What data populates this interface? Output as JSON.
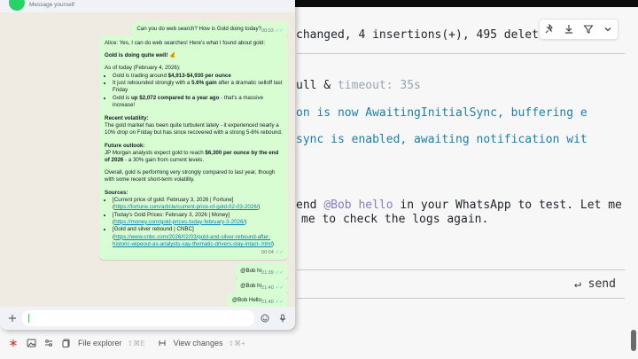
{
  "terminal": {
    "line_changed": "changed, 4 insertions(+), 495 deletions(-",
    "line_ull_prefix": "ull & ",
    "line_ull_timeout": "timeout: 35s",
    "line_sync": "on is now AwaitingInitialSync, buffering e",
    "line_notify": "sync is enabled, awaiting notification wit",
    "line_send_prefix": "end ",
    "line_send_mention": "@Bob hello",
    "line_send_suffix": " in your WhatsApp to test. Let me",
    "line_logs": "me to check the logs again.",
    "send_label": "↵ send",
    "toolbar_icons": [
      "pin-icon",
      "download-icon",
      "filter-icon",
      "chevron-down-icon"
    ]
  },
  "status_bar": {
    "file_explorer_label": "File explorer",
    "file_explorer_shortcut": "⇧⌘E",
    "view_changes_label": "View changes",
    "view_changes_shortcut": "⇧⌘+"
  },
  "whatsapp": {
    "header_subtitle": "Message yourself",
    "messages": [
      {
        "id": "m1",
        "text": "Can you do web search? How is Gold doing today?",
        "time": "00:03"
      },
      {
        "id": "m2",
        "intro": "Alice: Yes, I can do web searches! Here's what I found about gold:",
        "headline": "Gold is doing quite well! 💰",
        "asof": "As of today (February 4, 2026):",
        "bullets": [
          {
            "pre": "Gold is trading around ",
            "bold": "$4,913-$4,930 per ounce",
            "post": ""
          },
          {
            "pre": "It just rebounded strongly with a ",
            "bold": "5.6% gain",
            "post": " after a dramatic selloff last Friday"
          },
          {
            "pre": "Gold is ",
            "bold": "up $2,072 compared to a year ago",
            "post": " - that's a massive increase!"
          }
        ],
        "volatility_title": "Recent volatility:",
        "volatility_text": "The gold market has been quite turbulent lately - it experienced nearly a 10% drop on Friday but has since recovered with a strong 5-6% rebound.",
        "outlook_title": "Future outlook:",
        "outlook_pre": "JP Morgan analysts expect gold to reach ",
        "outlook_bold": "$6,300 per ounce by the end of 2026",
        "outlook_post": " - a 30% gain from current levels.",
        "overall": "Overall, gold is performing very strongly compared to last year, though with some recent short-term volatility.",
        "sources_title": "Sources:",
        "sources": [
          {
            "text": "[Current price of gold: February 3, 2026 | Fortune](",
            "link": "https://fortune.com/article/current-price-of-gold-02-03-2026/",
            "close": ")"
          },
          {
            "text": "[Today's Gold Prices: February 3, 2026 | Money](",
            "link": "https://money.com/gold-prices-today-february-3-2026/",
            "close": ")"
          },
          {
            "text": "[Gold and silver rebound | CNBC](",
            "link": "https://www.cnbc.com/2026/02/03/gold-and-silver-rebound-after-historic-wipeout-as-analysts-say-thematic-drivers-stay-intact-.html",
            "close": ")"
          }
        ],
        "time": "00:04"
      },
      {
        "id": "m3",
        "text": "@Bob hi",
        "time": "21:39"
      },
      {
        "id": "m4",
        "text": "@Bob hi",
        "time": "21:40"
      },
      {
        "id": "m5",
        "text": "@Bob Hello",
        "time": "21:40"
      }
    ]
  },
  "colors": {
    "bubble_out": "#d9fdd3",
    "chat_bg": "#efeae2",
    "terminal_accent": "#1c7fae",
    "read_ticks": "#53bdeb"
  }
}
